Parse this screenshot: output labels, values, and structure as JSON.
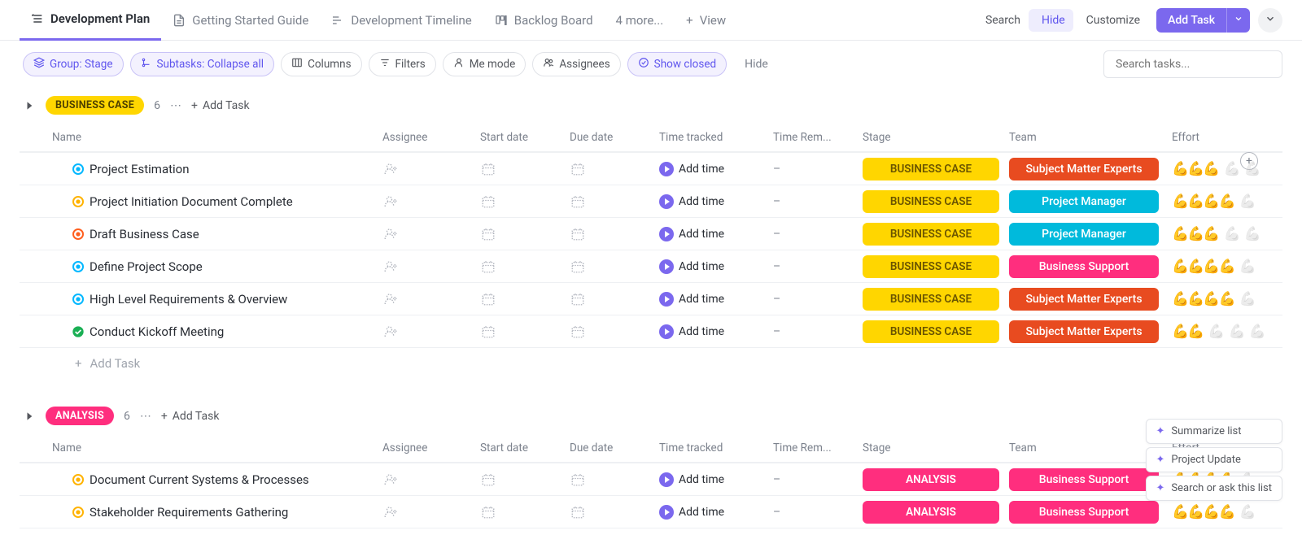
{
  "tabs": [
    {
      "label": "Development Plan",
      "active": true
    },
    {
      "label": "Getting Started Guide",
      "active": false
    },
    {
      "label": "Development Timeline",
      "active": false
    },
    {
      "label": "Backlog Board",
      "active": false
    }
  ],
  "tabs_more": "4 more...",
  "view_btn": "View",
  "top_actions": {
    "search": "Search",
    "hide": "Hide",
    "customize": "Customize",
    "add_task": "Add Task"
  },
  "filters": {
    "group": "Group: Stage",
    "subtasks": "Subtasks: Collapse all",
    "columns": "Columns",
    "filters": "Filters",
    "me_mode": "Me mode",
    "assignees": "Assignees",
    "show_closed": "Show closed",
    "hide": "Hide",
    "search_placeholder": "Search tasks..."
  },
  "table_headers": {
    "name": "Name",
    "assignee": "Assignee",
    "start_date": "Start date",
    "due_date": "Due date",
    "time_tracked": "Time tracked",
    "time_remaining": "Time Rem...",
    "stage": "Stage",
    "team": "Team",
    "effort": "Effort"
  },
  "add_time_label": "Add time",
  "dash": "–",
  "add_task_label": "Add Task",
  "add_task_row": "Add Task",
  "groups": [
    {
      "name": "BUSINESS CASE",
      "badge_class": "badge-business",
      "count": "6",
      "add_task": "Add Task",
      "rows": [
        {
          "status": "open-blue",
          "name": "Project Estimation",
          "stage": "BUSINESS CASE",
          "stage_class": "stage-business",
          "team": "Subject Matter Experts",
          "team_class": "team-sme",
          "effort": 3
        },
        {
          "status": "open-yellow",
          "name": "Project Initiation Document Complete",
          "stage": "BUSINESS CASE",
          "stage_class": "stage-business",
          "team": "Project Manager",
          "team_class": "team-pm",
          "effort": 4
        },
        {
          "status": "open-orange",
          "name": "Draft Business Case",
          "stage": "BUSINESS CASE",
          "stage_class": "stage-business",
          "team": "Project Manager",
          "team_class": "team-pm",
          "effort": 3
        },
        {
          "status": "open-blue",
          "name": "Define Project Scope",
          "stage": "BUSINESS CASE",
          "stage_class": "stage-business",
          "team": "Business Support",
          "team_class": "team-bs",
          "effort": 4
        },
        {
          "status": "open-blue",
          "name": "High Level Requirements & Overview",
          "stage": "BUSINESS CASE",
          "stage_class": "stage-business",
          "team": "Subject Matter Experts",
          "team_class": "team-sme",
          "effort": 4
        },
        {
          "status": "done",
          "name": "Conduct Kickoff Meeting",
          "stage": "BUSINESS CASE",
          "stage_class": "stage-business",
          "team": "Subject Matter Experts",
          "team_class": "team-sme",
          "effort": 2
        }
      ]
    },
    {
      "name": "ANALYSIS",
      "badge_class": "badge-analysis",
      "count": "6",
      "add_task": "Add Task",
      "rows": [
        {
          "status": "open-yellow",
          "name": "Document Current Systems & Processes",
          "stage": "ANALYSIS",
          "stage_class": "stage-analysis",
          "team": "Business Support",
          "team_class": "team-bs",
          "effort": 4
        },
        {
          "status": "open-yellow",
          "name": "Stakeholder Requirements Gathering",
          "stage": "ANALYSIS",
          "stage_class": "stage-analysis",
          "team": "Business Support",
          "team_class": "team-bs",
          "effort": 4
        }
      ]
    }
  ],
  "float_menu": {
    "summarize": "Summarize list",
    "project_update": "Project Update",
    "search_ask": "Search or ask this list"
  }
}
